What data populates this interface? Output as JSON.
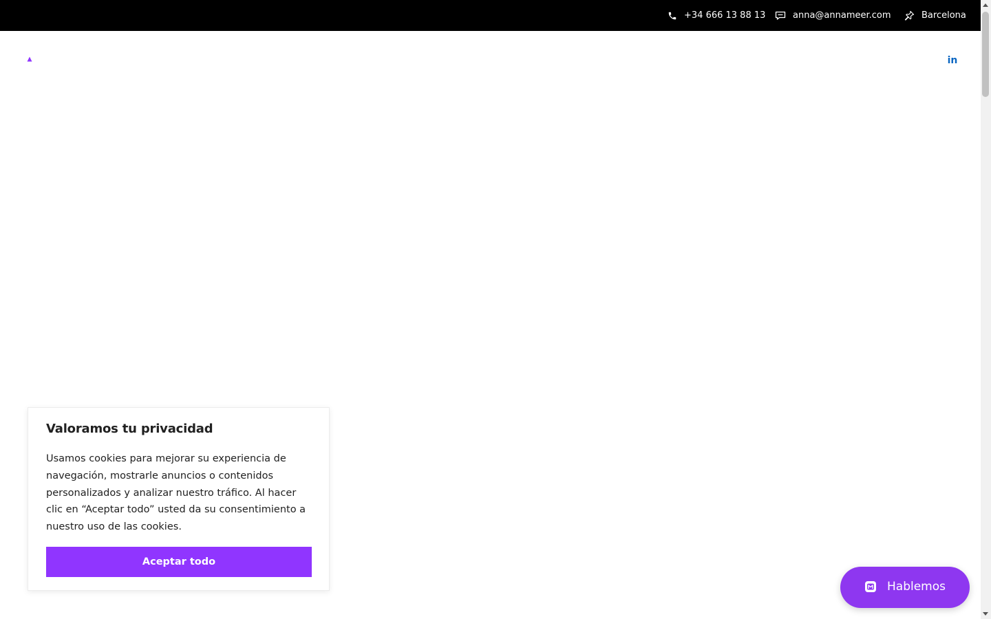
{
  "topbar": {
    "phone": "+34 666 13 88 13",
    "email": "anna@annameer.com",
    "location": "Barcelona",
    "phone_icon": "phone-icon",
    "email_icon": "message-icon",
    "location_icon": "pin-icon"
  },
  "header": {
    "logo_icon": "logo-triangle-icon",
    "social": {
      "linkedin_text": "in",
      "linkedin_icon": "linkedin-icon"
    }
  },
  "cookie_banner": {
    "title": "Valoramos tu privacidad",
    "text": "Usamos cookies para mejorar su experiencia de navegación, mostrarle anuncios o contenidos personalizados y analizar nuestro tráfico. Al hacer clic en “Aceptar todo” usted da su consentimiento a nuestro uso de las cookies.",
    "accept_label": "Aceptar todo"
  },
  "chat": {
    "label": "Hablemos",
    "icon": "chat-bubble-icon"
  },
  "colors": {
    "topbar_bg": "#000000",
    "accent": "#9035ff",
    "chat_bg": "#8e37f0",
    "linkedin": "#0a66c2"
  }
}
